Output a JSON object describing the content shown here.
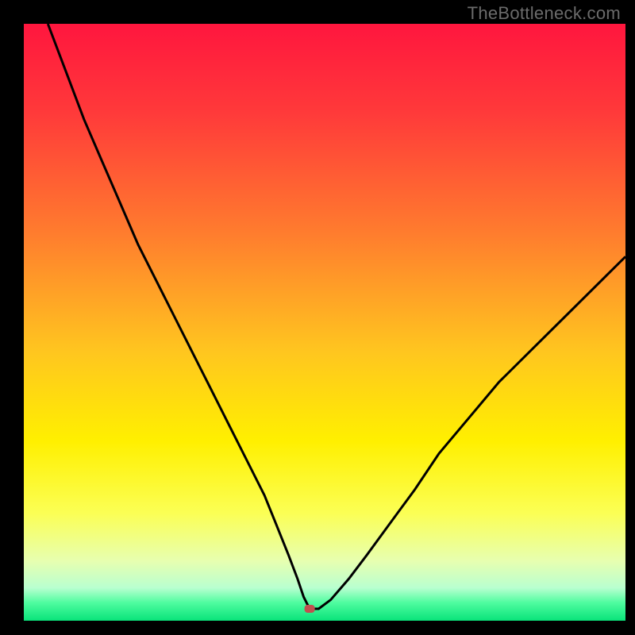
{
  "watermark": "TheBottleneck.com",
  "chart_data": {
    "type": "line",
    "title": "",
    "xlabel": "",
    "ylabel": "",
    "xlim": [
      0,
      100
    ],
    "ylim": [
      0,
      100
    ],
    "background": {
      "style": "vertical_gradient",
      "stops": [
        {
          "pos": 0.0,
          "color": "#ff163e"
        },
        {
          "pos": 0.15,
          "color": "#ff3a3a"
        },
        {
          "pos": 0.35,
          "color": "#ff7c2e"
        },
        {
          "pos": 0.55,
          "color": "#ffc61f"
        },
        {
          "pos": 0.7,
          "color": "#fff000"
        },
        {
          "pos": 0.82,
          "color": "#fbff55"
        },
        {
          "pos": 0.9,
          "color": "#e7ffb0"
        },
        {
          "pos": 0.945,
          "color": "#b9ffd0"
        },
        {
          "pos": 0.97,
          "color": "#4efc9f"
        },
        {
          "pos": 1.0,
          "color": "#09e37a"
        }
      ]
    },
    "marker": {
      "x": 47.5,
      "y": 2,
      "color": "#c0504f"
    },
    "series": [
      {
        "name": "bottleneck-curve",
        "color": "#000000",
        "x": [
          4,
          7,
          10,
          13,
          16,
          19,
          22,
          25,
          28,
          31,
          34,
          37,
          40,
          42,
          44,
          45.5,
          46.5,
          47.5,
          49,
          51,
          54,
          57,
          61,
          65,
          69,
          74,
          79,
          85,
          91,
          97,
          100
        ],
        "y": [
          100,
          92,
          84,
          77,
          70,
          63,
          57,
          51,
          45,
          39,
          33,
          27,
          21,
          16,
          11,
          7,
          4,
          2,
          2,
          3.5,
          7,
          11,
          16.5,
          22,
          28,
          34,
          40,
          46,
          52,
          58,
          61
        ]
      }
    ]
  }
}
